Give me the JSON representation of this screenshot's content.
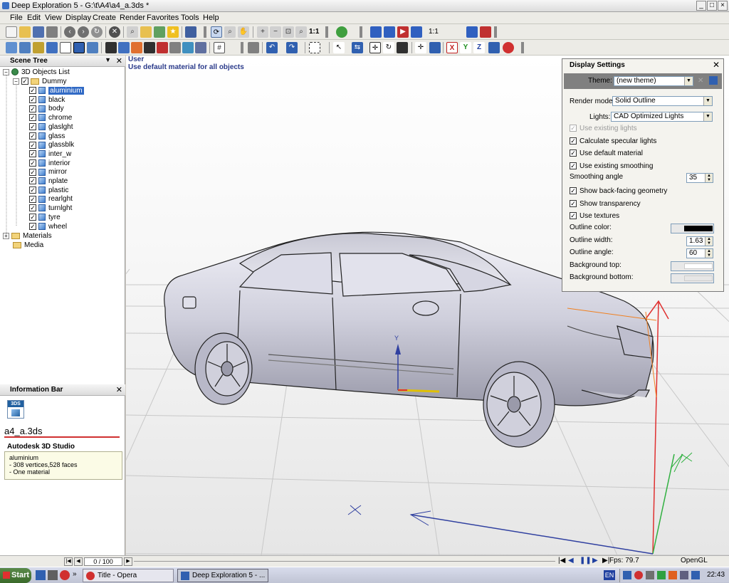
{
  "window": {
    "title": "Deep Exploration 5 - G:\\t\\A4\\a4_a.3ds *"
  },
  "menu": [
    "File",
    "Edit",
    "View",
    "Display",
    "Create",
    "Render",
    "Favorites",
    "Tools",
    "Help"
  ],
  "toolbar": {
    "zoom_11_a": "1:1",
    "zoom_11_b": "1:1",
    "axis_x": "X",
    "axis_y": "Y",
    "axis_z": "Z"
  },
  "scene_tree": {
    "title": "Scene Tree",
    "root": "3D Objects List",
    "group": "Dummy",
    "items": [
      "aluminium",
      "black",
      "body",
      "chrome",
      "glaslght",
      "glass",
      "glassblk",
      "inter_w",
      "interior",
      "mirror",
      "nplate",
      "plastic",
      "rearlght",
      "turnlght",
      "tyre",
      "wheel"
    ],
    "selected": "aluminium",
    "materials": "Materials",
    "media": "Media"
  },
  "info_bar": {
    "title": "Information Bar",
    "file_badge": "3DS",
    "filename": "a4_a.3ds",
    "format": "Autodesk 3D Studio",
    "details": [
      "aluminium",
      "- 308 vertices,528 faces",
      "- One material"
    ]
  },
  "viewport": {
    "camera": "User",
    "status": "Use default material for all objects",
    "axis_y_label": "Y"
  },
  "display_settings": {
    "title": "Display Settings",
    "theme_label": "Theme:",
    "theme_value": "(new theme)",
    "render_mode_label": "Render mode:",
    "render_mode_value": "Solid Outline",
    "lights_label": "Lights:",
    "lights_value": "CAD Optimized Lights",
    "checkboxes": [
      {
        "label": "Use existing lights",
        "checked": true,
        "disabled": true
      },
      {
        "label": "Calculate specular lights",
        "checked": true,
        "disabled": false
      },
      {
        "label": "Use default material",
        "checked": true,
        "disabled": false
      },
      {
        "label": "Use existing smoothing",
        "checked": true,
        "disabled": false
      }
    ],
    "smoothing_label": "Smoothing angle",
    "smoothing_value": "35",
    "checkboxes2": [
      {
        "label": "Show back-facing geometry",
        "checked": true
      },
      {
        "label": "Show transparency",
        "checked": true
      },
      {
        "label": "Use textures",
        "checked": true
      }
    ],
    "outline_color_label": "Outline color:",
    "outline_color": "#000000",
    "outline_width_label": "Outline width:",
    "outline_width_value": "1.63",
    "outline_angle_label": "Outline angle:",
    "outline_angle_value": "60",
    "bg_top_label": "Background top:",
    "bg_top_color": "#ffffff",
    "bg_bottom_label": "Background bottom:",
    "bg_bottom_color": "#e6e6e6"
  },
  "status_bar": {
    "frame": "0 / 100",
    "fps": "Fps: 79.7",
    "renderer": "OpenGL"
  },
  "taskbar": {
    "start": "Start",
    "task1": "Title - Opera",
    "task2": "Deep Exploration 5 - ...",
    "lang": "EN",
    "clock": "22:43"
  },
  "colors": {
    "selection": "#316ac5",
    "info_red_line": "#d03030",
    "axis_red": "#e03030",
    "axis_green": "#30b040",
    "axis_blue": "#3040a0"
  }
}
